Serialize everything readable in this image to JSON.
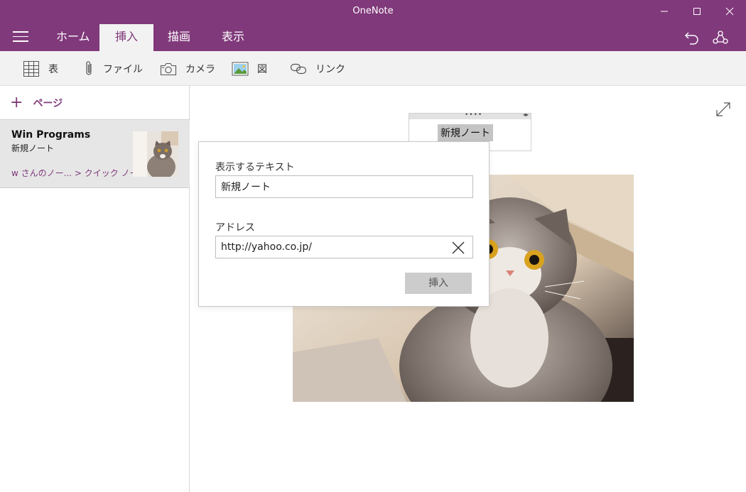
{
  "app": {
    "title": "OneNote"
  },
  "ribbon": {
    "tabs": [
      {
        "label": "ホーム"
      },
      {
        "label": "挿入"
      },
      {
        "label": "描画"
      },
      {
        "label": "表示"
      }
    ],
    "active_tab": "挿入"
  },
  "toolbar": {
    "items": [
      {
        "label": "表",
        "icon": "table-icon"
      },
      {
        "label": "ファイル",
        "icon": "paperclip-icon"
      },
      {
        "label": "カメラ",
        "icon": "camera-icon"
      },
      {
        "label": "図",
        "icon": "picture-icon"
      },
      {
        "label": "リンク",
        "icon": "link-icon"
      }
    ]
  },
  "sidebar": {
    "add_page_label": "ページ",
    "pages": [
      {
        "title": "Win Programs",
        "subtitle": "新規ノート",
        "path": "w さんのノー... > クイック ノート"
      }
    ]
  },
  "canvas": {
    "selected_text": "新規ノート"
  },
  "link_dialog": {
    "display_text_label": "表示するテキスト",
    "display_text_value": "新規ノート",
    "address_label": "アドレス",
    "address_value": "http://yahoo.co.jp/",
    "insert_button": "挿入"
  },
  "colors": {
    "accent": "#80397b",
    "toolbar_bg": "#f2f2f2",
    "selected_page_bg": "#e6e6e6"
  }
}
